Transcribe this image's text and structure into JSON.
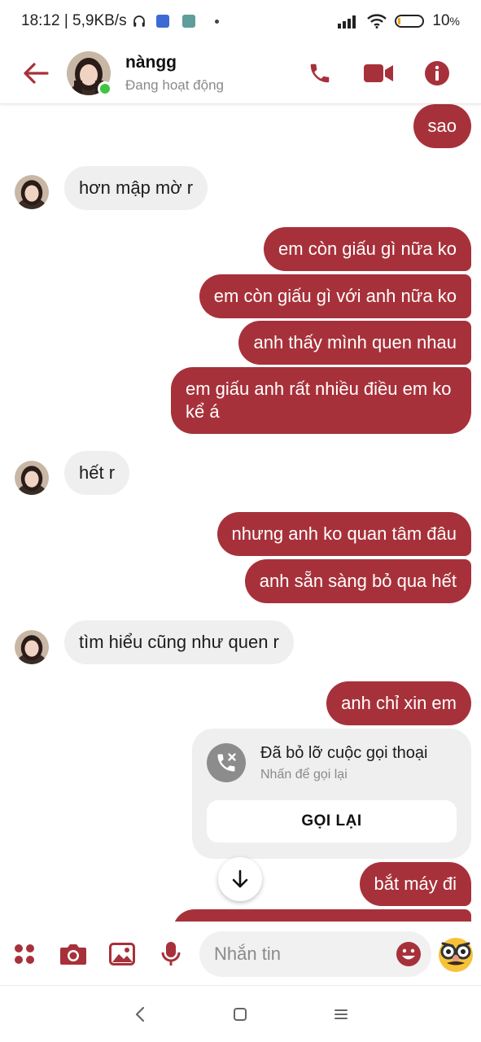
{
  "status_bar": {
    "time_net": "18:12 | 5,9KB/s",
    "battery": "10",
    "battery_unit": "%",
    "battery_level": 0.1,
    "icons": [
      "headphones-icon",
      "app-notification-icon",
      "app-notification-icon",
      "dot-icon",
      "signal-icon",
      "wifi-icon",
      "battery-icon"
    ]
  },
  "header": {
    "name": "nàngg",
    "status": "Đang hoạt động",
    "icons": [
      "back-arrow-icon",
      "phone-icon",
      "video-camera-icon",
      "info-icon"
    ]
  },
  "messages": [
    {
      "side": "out",
      "text": "sao"
    },
    {
      "side": "in",
      "text": "hơn mập mờ r"
    },
    {
      "side": "out",
      "text": "em còn giấu gì nữa ko"
    },
    {
      "side": "out",
      "text": "em còn giấu gì với anh nữa ko"
    },
    {
      "side": "out",
      "text": "anh thấy mình quen nhau"
    },
    {
      "side": "out",
      "text": "em giấu anh rất nhiều điều em ko kể á"
    },
    {
      "side": "in",
      "text": "hết r"
    },
    {
      "side": "out",
      "text": "nhưng anh ko quan tâm đâu"
    },
    {
      "side": "out",
      "text": "anh sẵn sàng bỏ qua hết"
    },
    {
      "side": "in",
      "text": "tìm hiểu cũng như quen r"
    },
    {
      "side": "out",
      "text": "anh chỉ xin em"
    },
    {
      "side": "out",
      "text": "bắt máy đi"
    }
  ],
  "missed_call": {
    "title": "Đã bỏ lỡ cuộc gọi thoại",
    "subtitle": "Nhấn để gọi lại",
    "button": "GỌI LẠI"
  },
  "composer": {
    "placeholder": "Nhắn tin",
    "icons": [
      "menu-dots-icon",
      "camera-icon",
      "image-icon",
      "microphone-icon",
      "emoji-icon",
      "sticker-icon"
    ]
  },
  "nav": {
    "icons": [
      "back-icon",
      "home-icon",
      "recents-icon"
    ]
  },
  "colors": {
    "accent": "#a7313a",
    "incoming_bubble": "#efefef",
    "online": "#3ec642"
  }
}
